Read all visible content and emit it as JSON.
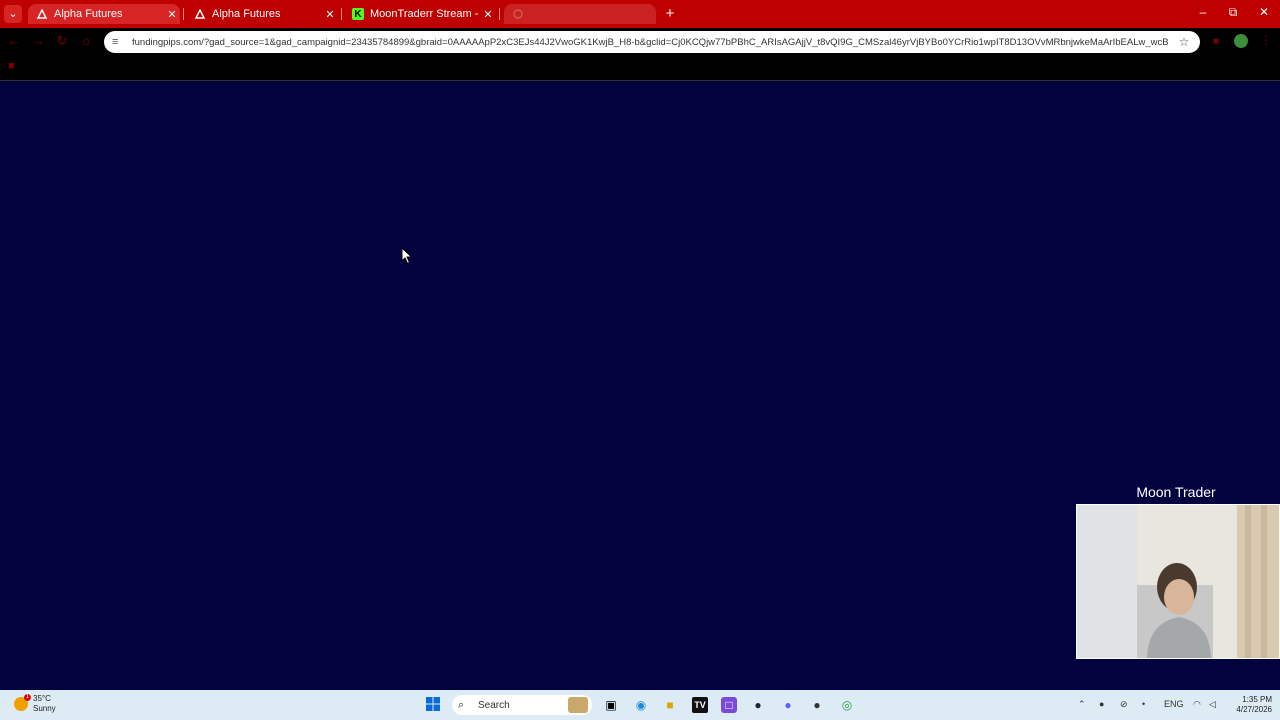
{
  "browser": {
    "tabs": [
      {
        "label": "Alpha Futures",
        "icon": "alpha-futures-icon",
        "active": true
      },
      {
        "label": "Alpha Futures",
        "icon": "alpha-futures-icon",
        "active": false
      },
      {
        "label": "MoonTraderr Stream - Watch Li",
        "icon": "kick-icon",
        "active": false
      },
      {
        "label": "",
        "icon": "loading-icon",
        "active": false
      }
    ],
    "url": "fundingpips.com/?gad_source=1&gad_campaignid=23435784899&gbraid=0AAAAApP2xC3EJs44J2VwoGK1KwjB_H8-b&gclid=Cj0KCQjw77bPBhC_ARIsAGAjjV_t8vQI9G_CMSzal46yrVjBYBo0YCrRio1wpIT8D13OVvMRbnjwkeMaArIbEALw_wcB"
  },
  "overlay": {
    "streamer_name": "Moon Trader"
  },
  "taskbar": {
    "weather_temp": "35°C",
    "weather_desc": "Sunny",
    "weather_badge": "1",
    "search_label": "Search",
    "language": "ENG",
    "time": "1:35 PM",
    "date": "4/27/2026"
  },
  "colors": {
    "tabbar": "#bf0000",
    "content_bg": "#02023f",
    "taskbar_bg": "#dcebf4"
  }
}
